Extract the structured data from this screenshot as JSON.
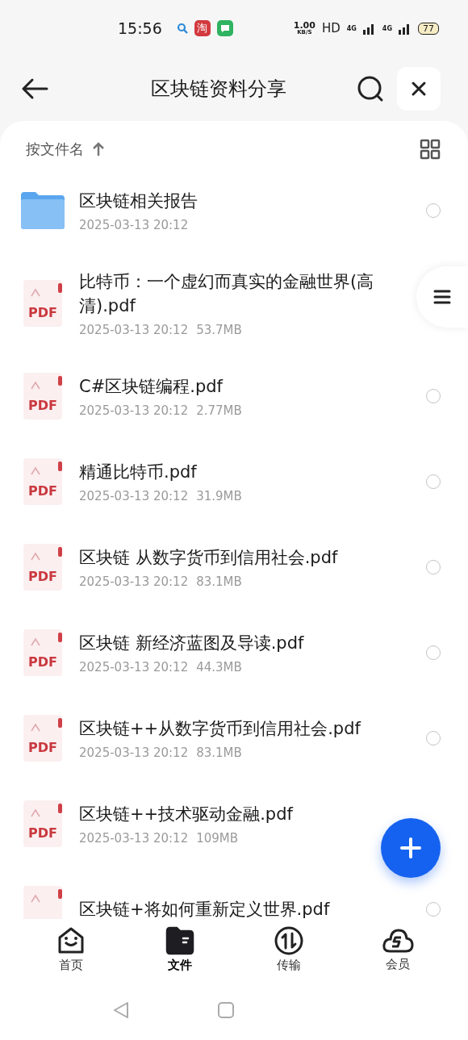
{
  "status_bar": {
    "time": "15:56",
    "app_badge": "淘",
    "net_speed": "1.00",
    "net_unit": "KB/S",
    "hd": "HD",
    "networks": [
      "4G",
      "4G"
    ],
    "battery": "77"
  },
  "header": {
    "title": "区块链资料分享"
  },
  "sort": {
    "label": "按文件名"
  },
  "files": [
    {
      "kind": "folder",
      "name": "区块链相关报告",
      "date": "2025-03-13 20:12",
      "selected": false
    },
    {
      "kind": "pdf",
      "label": "PDF",
      "name": "比特币：一个虚幻而真实的金融世界(高清).pdf",
      "date": "2025-03-13 20:12",
      "size": "53.7MB"
    },
    {
      "kind": "pdf",
      "label": "PDF",
      "name": "C#区块链编程.pdf",
      "date": "2025-03-13 20:12",
      "size": "2.77MB",
      "selected": false
    },
    {
      "kind": "pdf",
      "label": "PDF",
      "name": "精通比特币.pdf",
      "date": "2025-03-13 20:12",
      "size": "31.9MB",
      "selected": false
    },
    {
      "kind": "pdf",
      "label": "PDF",
      "name": "区块链  从数字货币到信用社会.pdf",
      "date": "2025-03-13 20:12",
      "size": "83.1MB",
      "selected": false
    },
    {
      "kind": "pdf",
      "label": "PDF",
      "name": "区块链  新经济蓝图及导读.pdf",
      "date": "2025-03-13 20:12",
      "size": "44.3MB",
      "selected": false
    },
    {
      "kind": "pdf",
      "label": "PDF",
      "name": "区块链++从数字货币到信用社会.pdf",
      "date": "2025-03-13 20:12",
      "size": "83.1MB",
      "selected": false
    },
    {
      "kind": "pdf",
      "label": "PDF",
      "name": "区块链++技术驱动金融.pdf",
      "date": "2025-03-13 20:12",
      "size": "109MB"
    },
    {
      "kind": "pdf",
      "name": "区块链+将如何重新定义世界.pdf",
      "selected": false
    }
  ],
  "tabs": [
    {
      "kind": "home",
      "label": "首页",
      "selected": false
    },
    {
      "kind": "files",
      "label": "文件",
      "selected": true
    },
    {
      "kind": "transfer",
      "label": "传输",
      "selected": false
    },
    {
      "kind": "vip",
      "label": "会员",
      "selected": false
    }
  ]
}
